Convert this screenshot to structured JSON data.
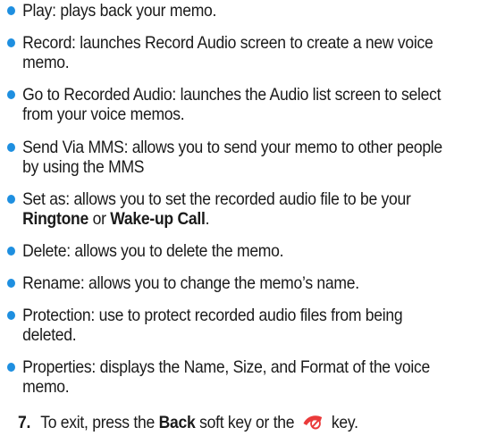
{
  "colors": {
    "bullet": "#1e8fe0",
    "end_key": "#ea3a3a"
  },
  "bullets": [
    {
      "lines": [
        "Play: plays back your memo."
      ]
    },
    {
      "lines": [
        "Record: launches Record Audio screen to create a new voice",
        "memo."
      ]
    },
    {
      "lines": [
        "Go to Recorded Audio: launches the Audio list screen to select",
        "from your voice memos."
      ]
    },
    {
      "lines": [
        "Send Via MMS: allows you to send your memo to other people",
        "by using the MMS"
      ]
    },
    {
      "line1": "Set as: allows you to set the recorded audio file to be your",
      "line2_bold1": "Ringtone",
      "line2_mid": " or ",
      "line2_bold2": "Wake-up Call",
      "line2_end": "."
    },
    {
      "lines": [
        "Delete: allows you to delete the memo."
      ]
    },
    {
      "lines": [
        "Rename: allows you to change the memo’s name."
      ]
    },
    {
      "lines": [
        "Protection: use to protect recorded audio files from being",
        "deleted."
      ]
    },
    {
      "lines": [
        "Properties: displays the Name, Size, and Format of the voice",
        "memo."
      ]
    }
  ],
  "step": {
    "number": "7.",
    "text_before": "To exit, press the ",
    "back_bold": "Back",
    "text_mid": " soft key or the ",
    "icon": "end-call-key-icon",
    "text_after": " key."
  }
}
